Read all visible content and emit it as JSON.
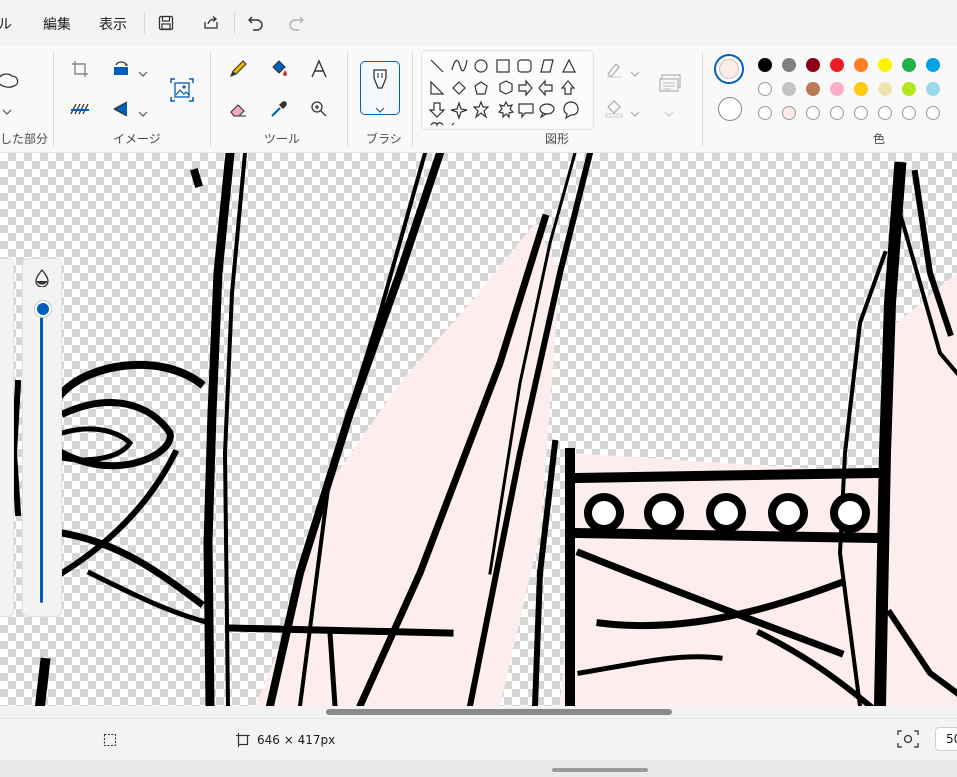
{
  "menubar": {
    "file_label": "ル",
    "edit_label": "編集",
    "view_label": "表示",
    "icons": [
      "save-icon",
      "share-icon",
      "undo-icon",
      "redo-icon"
    ]
  },
  "ribbon": {
    "groups": {
      "selection": "した部分",
      "image": "イメージ",
      "tools": "ツール",
      "brush": "ブラシ",
      "shapes": "図形",
      "colors": "色"
    }
  },
  "colors": {
    "accent": "#005fb8",
    "selected_primary": "#fdebea",
    "selected_secondary": "#ffffff",
    "palette_row1": [
      "#000000",
      "#7f7f7f",
      "#880015",
      "#ed1c24",
      "#ff7f27",
      "#fff200",
      "#22b14c",
      "#00a2e8"
    ],
    "palette_row2": [
      "#ffffff",
      "#c3c3c3",
      "#b97a57",
      "#ffaec9",
      "#ffc90e",
      "#efe4b0",
      "#b5e61d",
      "#99d9ea"
    ],
    "palette_row3": [
      "#ffffff",
      "#fdebea",
      "#ffffff",
      "#ffffff",
      "#ffffff",
      "#ffffff",
      "#ffffff",
      "#ffffff"
    ]
  },
  "status": {
    "image_size": "646 × 417px",
    "zoom": "50"
  }
}
